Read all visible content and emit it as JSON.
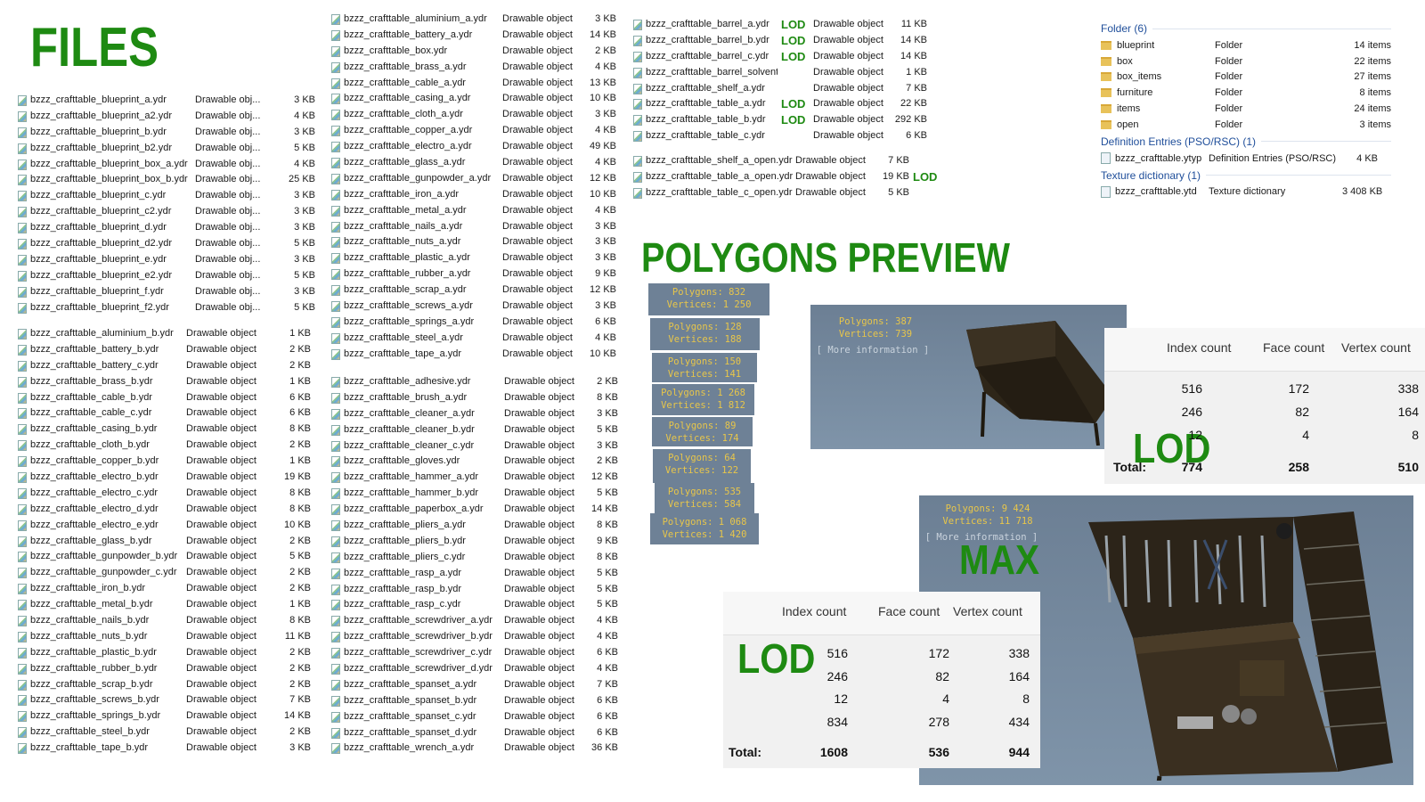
{
  "titles": {
    "files": "FILES",
    "polygons_preview": "POLYGONS PREVIEW"
  },
  "files": {
    "col1a": [
      {
        "name": "bzzz_crafttable_blueprint_a.ydr",
        "type": "Drawable obj...",
        "size": "3 KB"
      },
      {
        "name": "bzzz_crafttable_blueprint_a2.ydr",
        "type": "Drawable obj...",
        "size": "4 KB"
      },
      {
        "name": "bzzz_crafttable_blueprint_b.ydr",
        "type": "Drawable obj...",
        "size": "3 KB"
      },
      {
        "name": "bzzz_crafttable_blueprint_b2.ydr",
        "type": "Drawable obj...",
        "size": "5 KB"
      },
      {
        "name": "bzzz_crafttable_blueprint_box_a.ydr",
        "type": "Drawable obj...",
        "size": "4 KB"
      },
      {
        "name": "bzzz_crafttable_blueprint_box_b.ydr",
        "type": "Drawable obj...",
        "size": "25 KB"
      },
      {
        "name": "bzzz_crafttable_blueprint_c.ydr",
        "type": "Drawable obj...",
        "size": "3 KB"
      },
      {
        "name": "bzzz_crafttable_blueprint_c2.ydr",
        "type": "Drawable obj...",
        "size": "3 KB"
      },
      {
        "name": "bzzz_crafttable_blueprint_d.ydr",
        "type": "Drawable obj...",
        "size": "3 KB"
      },
      {
        "name": "bzzz_crafttable_blueprint_d2.ydr",
        "type": "Drawable obj...",
        "size": "5 KB"
      },
      {
        "name": "bzzz_crafttable_blueprint_e.ydr",
        "type": "Drawable obj...",
        "size": "3 KB"
      },
      {
        "name": "bzzz_crafttable_blueprint_e2.ydr",
        "type": "Drawable obj...",
        "size": "5 KB"
      },
      {
        "name": "bzzz_crafttable_blueprint_f.ydr",
        "type": "Drawable obj...",
        "size": "3 KB"
      },
      {
        "name": "bzzz_crafttable_blueprint_f2.ydr",
        "type": "Drawable obj...",
        "size": "5 KB"
      }
    ],
    "col1b": [
      {
        "name": "bzzz_crafttable_aluminium_b.ydr",
        "type": "Drawable object",
        "size": "1 KB"
      },
      {
        "name": "bzzz_crafttable_battery_b.ydr",
        "type": "Drawable object",
        "size": "2 KB"
      },
      {
        "name": "bzzz_crafttable_battery_c.ydr",
        "type": "Drawable object",
        "size": "2 KB"
      },
      {
        "name": "bzzz_crafttable_brass_b.ydr",
        "type": "Drawable object",
        "size": "1 KB"
      },
      {
        "name": "bzzz_crafttable_cable_b.ydr",
        "type": "Drawable object",
        "size": "6 KB"
      },
      {
        "name": "bzzz_crafttable_cable_c.ydr",
        "type": "Drawable object",
        "size": "6 KB"
      },
      {
        "name": "bzzz_crafttable_casing_b.ydr",
        "type": "Drawable object",
        "size": "8 KB"
      },
      {
        "name": "bzzz_crafttable_cloth_b.ydr",
        "type": "Drawable object",
        "size": "2 KB"
      },
      {
        "name": "bzzz_crafttable_copper_b.ydr",
        "type": "Drawable object",
        "size": "1 KB"
      },
      {
        "name": "bzzz_crafttable_electro_b.ydr",
        "type": "Drawable object",
        "size": "19 KB"
      },
      {
        "name": "bzzz_crafttable_electro_c.ydr",
        "type": "Drawable object",
        "size": "8 KB"
      },
      {
        "name": "bzzz_crafttable_electro_d.ydr",
        "type": "Drawable object",
        "size": "8 KB"
      },
      {
        "name": "bzzz_crafttable_electro_e.ydr",
        "type": "Drawable object",
        "size": "10 KB"
      },
      {
        "name": "bzzz_crafttable_glass_b.ydr",
        "type": "Drawable object",
        "size": "2 KB"
      },
      {
        "name": "bzzz_crafttable_gunpowder_b.ydr",
        "type": "Drawable object",
        "size": "5 KB"
      },
      {
        "name": "bzzz_crafttable_gunpowder_c.ydr",
        "type": "Drawable object",
        "size": "2 KB"
      },
      {
        "name": "bzzz_crafttable_iron_b.ydr",
        "type": "Drawable object",
        "size": "2 KB"
      },
      {
        "name": "bzzz_crafttable_metal_b.ydr",
        "type": "Drawable object",
        "size": "1 KB"
      },
      {
        "name": "bzzz_crafttable_nails_b.ydr",
        "type": "Drawable object",
        "size": "8 KB"
      },
      {
        "name": "bzzz_crafttable_nuts_b.ydr",
        "type": "Drawable object",
        "size": "11 KB"
      },
      {
        "name": "bzzz_crafttable_plastic_b.ydr",
        "type": "Drawable object",
        "size": "2 KB"
      },
      {
        "name": "bzzz_crafttable_rubber_b.ydr",
        "type": "Drawable object",
        "size": "2 KB"
      },
      {
        "name": "bzzz_crafttable_scrap_b.ydr",
        "type": "Drawable object",
        "size": "2 KB"
      },
      {
        "name": "bzzz_crafttable_screws_b.ydr",
        "type": "Drawable object",
        "size": "7 KB"
      },
      {
        "name": "bzzz_crafttable_springs_b.ydr",
        "type": "Drawable object",
        "size": "14 KB"
      },
      {
        "name": "bzzz_crafttable_steel_b.ydr",
        "type": "Drawable object",
        "size": "2 KB"
      },
      {
        "name": "bzzz_crafttable_tape_b.ydr",
        "type": "Drawable object",
        "size": "3 KB"
      }
    ],
    "col2a": [
      {
        "name": "bzzz_crafttable_aluminium_a.ydr",
        "type": "Drawable object",
        "size": "3 KB"
      },
      {
        "name": "bzzz_crafttable_battery_a.ydr",
        "type": "Drawable object",
        "size": "14 KB"
      },
      {
        "name": "bzzz_crafttable_box.ydr",
        "type": "Drawable object",
        "size": "2 KB"
      },
      {
        "name": "bzzz_crafttable_brass_a.ydr",
        "type": "Drawable object",
        "size": "4 KB"
      },
      {
        "name": "bzzz_crafttable_cable_a.ydr",
        "type": "Drawable object",
        "size": "13 KB"
      },
      {
        "name": "bzzz_crafttable_casing_a.ydr",
        "type": "Drawable object",
        "size": "10 KB"
      },
      {
        "name": "bzzz_crafttable_cloth_a.ydr",
        "type": "Drawable object",
        "size": "3 KB"
      },
      {
        "name": "bzzz_crafttable_copper_a.ydr",
        "type": "Drawable object",
        "size": "4 KB"
      },
      {
        "name": "bzzz_crafttable_electro_a.ydr",
        "type": "Drawable object",
        "size": "49 KB"
      },
      {
        "name": "bzzz_crafttable_glass_a.ydr",
        "type": "Drawable object",
        "size": "4 KB"
      },
      {
        "name": "bzzz_crafttable_gunpowder_a.ydr",
        "type": "Drawable object",
        "size": "12 KB"
      },
      {
        "name": "bzzz_crafttable_iron_a.ydr",
        "type": "Drawable object",
        "size": "10 KB"
      },
      {
        "name": "bzzz_crafttable_metal_a.ydr",
        "type": "Drawable object",
        "size": "4 KB"
      },
      {
        "name": "bzzz_crafttable_nails_a.ydr",
        "type": "Drawable object",
        "size": "3 KB"
      },
      {
        "name": "bzzz_crafttable_nuts_a.ydr",
        "type": "Drawable object",
        "size": "3 KB"
      },
      {
        "name": "bzzz_crafttable_plastic_a.ydr",
        "type": "Drawable object",
        "size": "3 KB"
      },
      {
        "name": "bzzz_crafttable_rubber_a.ydr",
        "type": "Drawable object",
        "size": "9 KB"
      },
      {
        "name": "bzzz_crafttable_scrap_a.ydr",
        "type": "Drawable object",
        "size": "12 KB"
      },
      {
        "name": "bzzz_crafttable_screws_a.ydr",
        "type": "Drawable object",
        "size": "3 KB"
      },
      {
        "name": "bzzz_crafttable_springs_a.ydr",
        "type": "Drawable object",
        "size": "6 KB"
      },
      {
        "name": "bzzz_crafttable_steel_a.ydr",
        "type": "Drawable object",
        "size": "4 KB"
      },
      {
        "name": "bzzz_crafttable_tape_a.ydr",
        "type": "Drawable object",
        "size": "10 KB"
      }
    ],
    "col2b": [
      {
        "name": "bzzz_crafttable_adhesive.ydr",
        "type": "Drawable object",
        "size": "2 KB"
      },
      {
        "name": "bzzz_crafttable_brush_a.ydr",
        "type": "Drawable object",
        "size": "8 KB"
      },
      {
        "name": "bzzz_crafttable_cleaner_a.ydr",
        "type": "Drawable object",
        "size": "3 KB"
      },
      {
        "name": "bzzz_crafttable_cleaner_b.ydr",
        "type": "Drawable object",
        "size": "5 KB"
      },
      {
        "name": "bzzz_crafttable_cleaner_c.ydr",
        "type": "Drawable object",
        "size": "3 KB"
      },
      {
        "name": "bzzz_crafttable_gloves.ydr",
        "type": "Drawable object",
        "size": "2 KB"
      },
      {
        "name": "bzzz_crafttable_hammer_a.ydr",
        "type": "Drawable object",
        "size": "12 KB"
      },
      {
        "name": "bzzz_crafttable_hammer_b.ydr",
        "type": "Drawable object",
        "size": "5 KB"
      },
      {
        "name": "bzzz_crafttable_paperbox_a.ydr",
        "type": "Drawable object",
        "size": "14 KB"
      },
      {
        "name": "bzzz_crafttable_pliers_a.ydr",
        "type": "Drawable object",
        "size": "8 KB"
      },
      {
        "name": "bzzz_crafttable_pliers_b.ydr",
        "type": "Drawable object",
        "size": "9 KB"
      },
      {
        "name": "bzzz_crafttable_pliers_c.ydr",
        "type": "Drawable object",
        "size": "8 KB"
      },
      {
        "name": "bzzz_crafttable_rasp_a.ydr",
        "type": "Drawable object",
        "size": "5 KB"
      },
      {
        "name": "bzzz_crafttable_rasp_b.ydr",
        "type": "Drawable object",
        "size": "5 KB"
      },
      {
        "name": "bzzz_crafttable_rasp_c.ydr",
        "type": "Drawable object",
        "size": "5 KB"
      },
      {
        "name": "bzzz_crafttable_screwdriver_a.ydr",
        "type": "Drawable object",
        "size": "4 KB"
      },
      {
        "name": "bzzz_crafttable_screwdriver_b.ydr",
        "type": "Drawable object",
        "size": "4 KB"
      },
      {
        "name": "bzzz_crafttable_screwdriver_c.ydr",
        "type": "Drawable object",
        "size": "6 KB"
      },
      {
        "name": "bzzz_crafttable_screwdriver_d.ydr",
        "type": "Drawable object",
        "size": "4 KB"
      },
      {
        "name": "bzzz_crafttable_spanset_a.ydr",
        "type": "Drawable object",
        "size": "7 KB"
      },
      {
        "name": "bzzz_crafttable_spanset_b.ydr",
        "type": "Drawable object",
        "size": "6 KB"
      },
      {
        "name": "bzzz_crafttable_spanset_c.ydr",
        "type": "Drawable object",
        "size": "6 KB"
      },
      {
        "name": "bzzz_crafttable_spanset_d.ydr",
        "type": "Drawable object",
        "size": "6 KB"
      },
      {
        "name": "bzzz_crafttable_wrench_a.ydr",
        "type": "Drawable object",
        "size": "36 KB"
      }
    ],
    "col3a": [
      {
        "name": "bzzz_crafttable_barrel_a.ydr",
        "lod": "LOD",
        "type": "Drawable object",
        "size": "11 KB"
      },
      {
        "name": "bzzz_crafttable_barrel_b.ydr",
        "lod": "LOD",
        "type": "Drawable object",
        "size": "14 KB"
      },
      {
        "name": "bzzz_crafttable_barrel_c.ydr",
        "lod": "LOD",
        "type": "Drawable object",
        "size": "14 KB"
      },
      {
        "name": "bzzz_crafttable_barrel_solvent.ydr",
        "lod": "",
        "type": "Drawable object",
        "size": "1 KB"
      },
      {
        "name": "bzzz_crafttable_shelf_a.ydr",
        "lod": "",
        "type": "Drawable object",
        "size": "7 KB"
      },
      {
        "name": "bzzz_crafttable_table_a.ydr",
        "lod": "LOD",
        "type": "Drawable object",
        "size": "22 KB"
      },
      {
        "name": "bzzz_crafttable_table_b.ydr",
        "lod": "LOD",
        "type": "Drawable object",
        "size": "292 KB"
      },
      {
        "name": "bzzz_crafttable_table_c.ydr",
        "lod": "",
        "type": "Drawable object",
        "size": "6 KB"
      }
    ],
    "col3b": [
      {
        "name": "bzzz_crafttable_shelf_a_open.ydr",
        "type": "Drawable object",
        "size": "7 KB",
        "lod": ""
      },
      {
        "name": "bzzz_crafttable_table_a_open.ydr",
        "type": "Drawable object",
        "size": "19 KB",
        "lod": "LOD"
      },
      {
        "name": "bzzz_crafttable_table_c_open.ydr",
        "type": "Drawable object",
        "size": "5 KB",
        "lod": ""
      }
    ]
  },
  "groups": {
    "folder_header": "Folder (6)",
    "folders": [
      {
        "name": "blueprint",
        "type": "Folder",
        "size": "14 items"
      },
      {
        "name": "box",
        "type": "Folder",
        "size": "22 items"
      },
      {
        "name": "box_items",
        "type": "Folder",
        "size": "27 items"
      },
      {
        "name": "furniture",
        "type": "Folder",
        "size": "8 items"
      },
      {
        "name": "items",
        "type": "Folder",
        "size": "24 items"
      },
      {
        "name": "open",
        "type": "Folder",
        "size": "3 items"
      }
    ],
    "def_header": "Definition Entries (PSO/RSC) (1)",
    "def_item": {
      "name": "bzzz_crafttable.ytyp",
      "type": "Definition Entries (PSO/RSC)",
      "size": "4 KB"
    },
    "tex_header": "Texture dictionary (1)",
    "tex_item": {
      "name": "bzzz_crafttable.ytd",
      "type": "Texture dictionary",
      "size": "3 408 KB"
    }
  },
  "poly_boxes": [
    {
      "p": "Polygons: 832",
      "v": "Vertices: 1 250"
    },
    {
      "p": "Polygons: 128",
      "v": "Vertices: 188"
    },
    {
      "p": "Polygons: 150",
      "v": "Vertices: 141"
    },
    {
      "p": "Polygons: 1 268",
      "v": "Vertices: 1 812"
    },
    {
      "p": "Polygons: 89",
      "v": "Vertices: 174"
    },
    {
      "p": "Polygons: 64",
      "v": "Vertices: 122"
    },
    {
      "p": "Polygons: 535",
      "v": "Vertices: 584"
    },
    {
      "p": "Polygons: 1 068",
      "v": "Vertices: 1 420"
    }
  ],
  "viewport1": {
    "p": "Polygons: 387",
    "v": "Vertices: 739",
    "more": "[ More information ]"
  },
  "viewport2": {
    "p": "Polygons: 9 424",
    "v": "Vertices: 11 718",
    "more": "[ More information ]"
  },
  "stats1": {
    "headers": [
      "Index count",
      "Face count",
      "Vertex count"
    ],
    "rows": [
      [
        "516",
        "172",
        "338"
      ],
      [
        "246",
        "82",
        "164"
      ],
      [
        "12",
        "4",
        "8"
      ]
    ],
    "total_label": "Total:",
    "total": [
      "774",
      "258",
      "510"
    ],
    "lod": "LOD"
  },
  "stats2": {
    "headers": [
      "Index count",
      "Face count",
      "Vertex count"
    ],
    "rows": [
      [
        "516",
        "172",
        "338"
      ],
      [
        "246",
        "82",
        "164"
      ],
      [
        "12",
        "4",
        "8"
      ],
      [
        "834",
        "278",
        "434"
      ]
    ],
    "total_label": "Total:",
    "total": [
      "1608",
      "536",
      "944"
    ],
    "lod": "LOD"
  },
  "max_label": "MAX",
  "colors": {
    "accent_green": "#1e8a12",
    "poly_text": "#e8c64a",
    "poly_bg": "#6e8196"
  }
}
